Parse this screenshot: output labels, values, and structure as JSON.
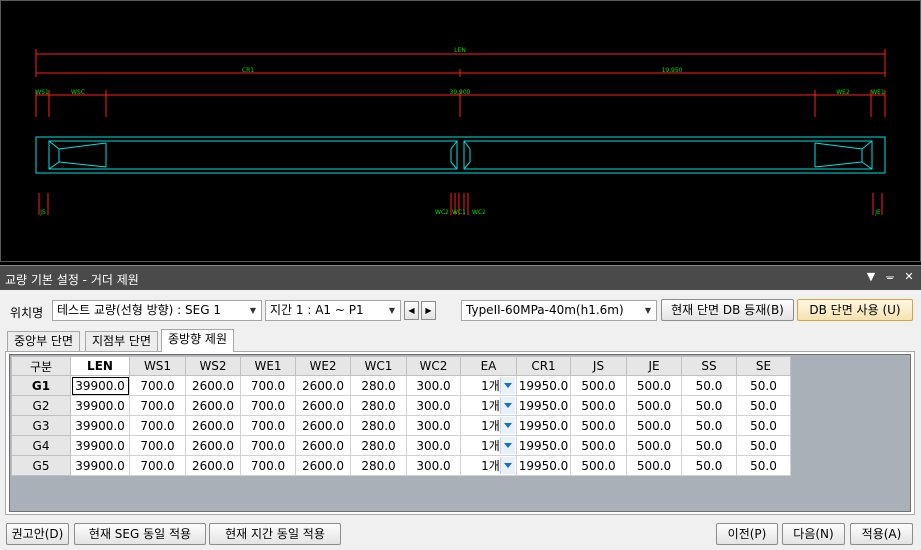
{
  "cad": {
    "labels": {
      "len": "LEN",
      "cr1": "CR1",
      "cr1_value": "19,950",
      "span_value": "39,900",
      "ws1": "WS1",
      "wsc": "WSC",
      "we2": "WE2",
      "we1": "WE1",
      "js": "JS",
      "je": "JE",
      "wc_left": "WC2",
      "wc_mid": "WC1",
      "wc_right": "WC2"
    },
    "colors": {
      "dimension": "#ff2020",
      "beam": "#00e0e0",
      "text": "#00e000"
    }
  },
  "panel": {
    "title": "교량 기본 설정 - 거더 제원",
    "icons": [
      "dropdown-icon",
      "pin-icon",
      "close-icon"
    ]
  },
  "toolbar": {
    "location_label": "위치명",
    "location_value": "테스트 교량(선형 방향) : SEG 1",
    "span_value": "지간 1 : A1 ~ P1",
    "section_type_value": "TypeII-60MPa-40m(h1.6m)",
    "register_button": "현재 단면 DB 등재(B)",
    "use_db_button": "DB 단면 사용 (U)"
  },
  "tabs": [
    {
      "label": "중앙부 단면"
    },
    {
      "label": "지점부 단면"
    },
    {
      "label": "종방향 제원"
    }
  ],
  "grid": {
    "columns": [
      "구분",
      "LEN",
      "WS1",
      "WS2",
      "WE1",
      "WE2",
      "WC1",
      "WC2",
      "EA",
      "CR1",
      "JS",
      "JE",
      "SS",
      "SE"
    ],
    "rows": [
      {
        "name": "G1",
        "cells": [
          "39900.0",
          "700.0",
          "2600.0",
          "700.0",
          "2600.0",
          "280.0",
          "300.0",
          "1개",
          "19950.0",
          "500.0",
          "500.0",
          "50.0",
          "50.0"
        ]
      },
      {
        "name": "G2",
        "cells": [
          "39900.0",
          "700.0",
          "2600.0",
          "700.0",
          "2600.0",
          "280.0",
          "300.0",
          "1개",
          "19950.0",
          "500.0",
          "500.0",
          "50.0",
          "50.0"
        ]
      },
      {
        "name": "G3",
        "cells": [
          "39900.0",
          "700.0",
          "2600.0",
          "700.0",
          "2600.0",
          "280.0",
          "300.0",
          "1개",
          "19950.0",
          "500.0",
          "500.0",
          "50.0",
          "50.0"
        ]
      },
      {
        "name": "G4",
        "cells": [
          "39900.0",
          "700.0",
          "2600.0",
          "700.0",
          "2600.0",
          "280.0",
          "300.0",
          "1개",
          "19950.0",
          "500.0",
          "500.0",
          "50.0",
          "50.0"
        ]
      },
      {
        "name": "G5",
        "cells": [
          "39900.0",
          "700.0",
          "2600.0",
          "700.0",
          "2600.0",
          "280.0",
          "300.0",
          "1개",
          "19950.0",
          "500.0",
          "500.0",
          "50.0",
          "50.0"
        ]
      }
    ]
  },
  "footer": {
    "recommend_button": "권고안(D)",
    "apply_seg_button": "현재 SEG 동일 적용",
    "apply_span_button": "현재 지간 동일 적용",
    "prev_button": "이전(P)",
    "next_button": "다음(N)",
    "apply_button": "적용(A)"
  }
}
